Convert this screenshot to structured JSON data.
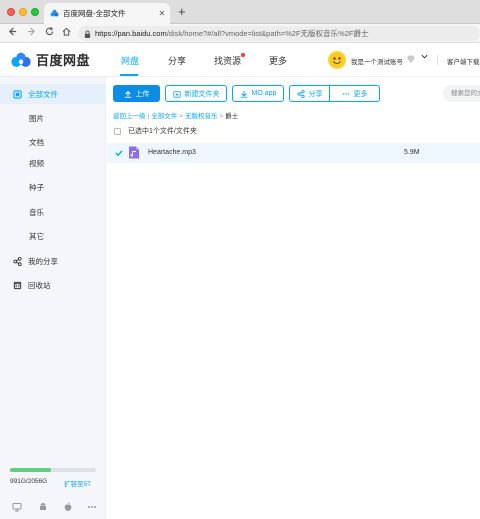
{
  "browser": {
    "tab_title": "百度网盘-全部文件",
    "tab_close": "✕",
    "new_tab": "+",
    "url_host": "https://pan.baidu.com",
    "url_path": "/disk/home?#/all?vmode=list&path=%2F无版权音乐%2F爵士"
  },
  "header": {
    "logo_text": "百度网盘",
    "nav": [
      "网盘",
      "分享",
      "找资源",
      "更多"
    ],
    "active_nav": "网盘",
    "user_name": "我是一个测试账号",
    "client_download": "客户端下载"
  },
  "sidebar": {
    "all_files": "全部文件",
    "categories": [
      "图片",
      "文档",
      "视频",
      "种子",
      "音乐",
      "其它"
    ],
    "my_share": "我的分享",
    "recycle": "回收站",
    "quota_text": "991G/2056G",
    "quota_upgrade": "扩容至5T",
    "quota_fraction": 0.48
  },
  "toolbar": {
    "upload": "上传",
    "new_folder": "新建文件夹",
    "mo_app": "MO.app",
    "share": "分享",
    "more": "更多",
    "search_placeholder": "搜索您的文件"
  },
  "breadcrumb": {
    "back": "返回上一级",
    "sep": "|",
    "items": [
      "全部文件",
      "无版权音乐"
    ],
    "arrow": ">",
    "current": "爵士"
  },
  "selection_text": "已选中1个文件/文件夹",
  "files": [
    {
      "name": "Heartache.mp3",
      "size": "5.9M",
      "checked": true
    }
  ],
  "colors": {
    "accent": "#06a7ff",
    "primary_btn": "#0a8de5",
    "row_selected": "#eef6fe",
    "quota_fill": "#5fcf80"
  }
}
